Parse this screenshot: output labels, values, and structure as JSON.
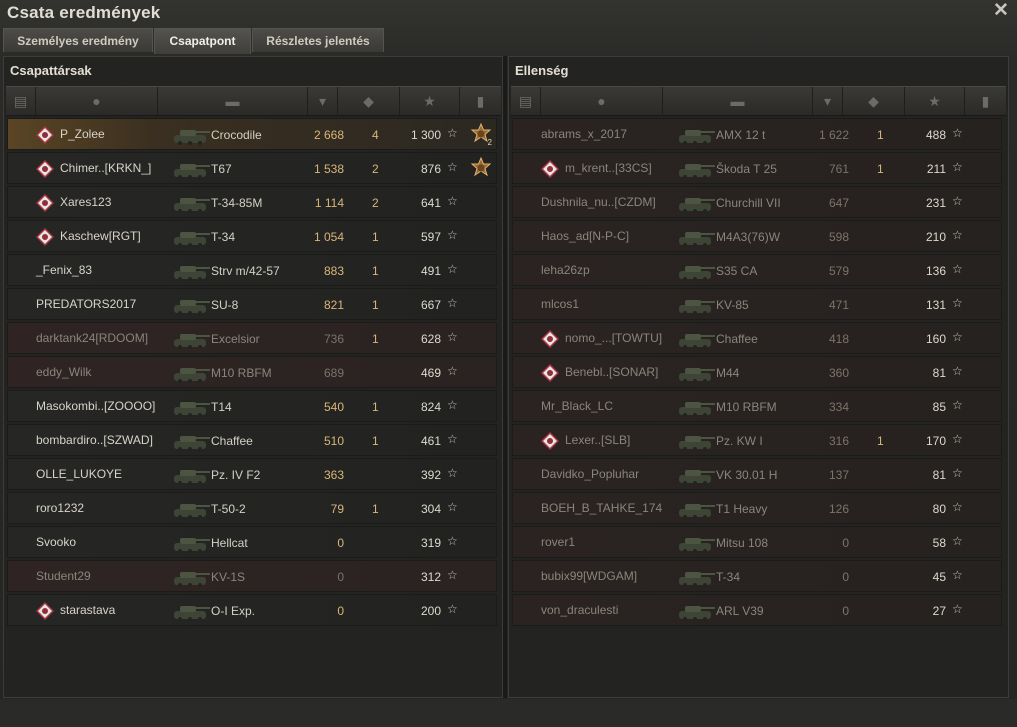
{
  "window": {
    "title": "Csata eredmények"
  },
  "tabs": [
    {
      "label": "Személyes eredmény",
      "active": false
    },
    {
      "label": "Csapatpont",
      "active": true
    },
    {
      "label": "Részletes jelentés",
      "active": false
    }
  ],
  "allies": {
    "title": "Csapattársak",
    "rows": [
      {
        "name": "P_Zolee",
        "vehicle": "Crocodile",
        "damage": "2 668",
        "kills": "4",
        "xp": "1 300",
        "badge": "rank-badge-icon",
        "medal": "2",
        "style": "me"
      },
      {
        "name": "Chimer..[KRKN_]",
        "vehicle": "T67",
        "damage": "1 538",
        "kills": "2",
        "xp": "876",
        "badge": "rank-badge-icon",
        "medal": "",
        "style": ""
      },
      {
        "name": "Xares123",
        "vehicle": "T-34-85M",
        "damage": "1 114",
        "kills": "2",
        "xp": "641",
        "badge": "rank-badge-icon",
        "medal": "",
        "style": ""
      },
      {
        "name": "Kaschew[RGT]",
        "vehicle": "T-34",
        "damage": "1 054",
        "kills": "1",
        "xp": "597",
        "badge": "rank-badge-icon",
        "medal": "",
        "style": ""
      },
      {
        "name": "_Fenix_83",
        "vehicle": "Strv m/42-57",
        "damage": "883",
        "kills": "1",
        "xp": "491",
        "badge": "",
        "medal": "",
        "style": ""
      },
      {
        "name": "PREDATORS2017",
        "vehicle": "SU-8",
        "damage": "821",
        "kills": "1",
        "xp": "667",
        "badge": "",
        "medal": "",
        "style": ""
      },
      {
        "name": "darktank24[RDOOM]",
        "vehicle": "Excelsior",
        "damage": "736",
        "kills": "1",
        "xp": "628",
        "badge": "",
        "medal": "",
        "style": "dead"
      },
      {
        "name": "eddy_Wilk",
        "vehicle": "M10 RBFM",
        "damage": "689",
        "kills": "",
        "xp": "469",
        "badge": "",
        "medal": "",
        "style": "dead"
      },
      {
        "name": "Masokombi..[ZOOOO]",
        "vehicle": "T14",
        "damage": "540",
        "kills": "1",
        "xp": "824",
        "badge": "",
        "medal": "",
        "style": ""
      },
      {
        "name": "bombardiro..[SZWAD]",
        "vehicle": "Chaffee",
        "damage": "510",
        "kills": "1",
        "xp": "461",
        "badge": "",
        "medal": "",
        "style": ""
      },
      {
        "name": "OLLE_LUKOYE",
        "vehicle": "Pz. IV F2",
        "damage": "363",
        "kills": "",
        "xp": "392",
        "badge": "",
        "medal": "",
        "style": ""
      },
      {
        "name": "roro1232",
        "vehicle": "T-50-2",
        "damage": "79",
        "kills": "1",
        "xp": "304",
        "badge": "",
        "medal": "",
        "style": ""
      },
      {
        "name": "Svooko",
        "vehicle": "Hellcat",
        "damage": "0",
        "kills": "",
        "xp": "319",
        "badge": "",
        "medal": "",
        "style": ""
      },
      {
        "name": "Student29",
        "vehicle": "KV-1S",
        "damage": "0",
        "kills": "",
        "xp": "312",
        "badge": "",
        "medal": "",
        "style": "dead"
      },
      {
        "name": "starastava",
        "vehicle": "O-I Exp.",
        "damage": "0",
        "kills": "",
        "xp": "200",
        "badge": "rank-badge-icon",
        "medal": "",
        "style": ""
      }
    ]
  },
  "enemies": {
    "title": "Ellenség",
    "rows": [
      {
        "name": "abrams_x_2017",
        "vehicle": "AMX 12 t",
        "damage": "1 622",
        "kills": "1",
        "xp": "488",
        "badge": "",
        "style": "dead"
      },
      {
        "name": "m_krent..[33CS]",
        "vehicle": "Škoda T 25",
        "damage": "761",
        "kills": "1",
        "xp": "211",
        "badge": "rank-badge-icon",
        "style": "dead"
      },
      {
        "name": "Dushnila_nu..[CZDM]",
        "vehicle": "Churchill VII",
        "damage": "647",
        "kills": "",
        "xp": "231",
        "badge": "",
        "style": "dead"
      },
      {
        "name": "Haos_ad[N-P-C]",
        "vehicle": "M4A3(76)W",
        "damage": "598",
        "kills": "",
        "xp": "210",
        "badge": "",
        "style": "dead"
      },
      {
        "name": "leha26zp",
        "vehicle": "S35 CA",
        "damage": "579",
        "kills": "",
        "xp": "136",
        "badge": "",
        "style": "dead"
      },
      {
        "name": "mlcos1",
        "vehicle": "KV-85",
        "damage": "471",
        "kills": "",
        "xp": "131",
        "badge": "",
        "style": "dead"
      },
      {
        "name": "nomo_...[TOWTU]",
        "vehicle": "Chaffee",
        "damage": "418",
        "kills": "",
        "xp": "160",
        "badge": "rank-badge-icon",
        "style": "dead"
      },
      {
        "name": "Benebl..[SONAR]",
        "vehicle": "M44",
        "damage": "360",
        "kills": "",
        "xp": "81",
        "badge": "rank-badge-icon",
        "style": "dead"
      },
      {
        "name": "Mr_Black_LC",
        "vehicle": "M10 RBFM",
        "damage": "334",
        "kills": "",
        "xp": "85",
        "badge": "",
        "style": "dead"
      },
      {
        "name": "Lexer..[SLB]",
        "vehicle": "Pz. KW I",
        "damage": "316",
        "kills": "1",
        "xp": "170",
        "badge": "rank-badge-icon",
        "style": "dead"
      },
      {
        "name": "Davidko_Popluhar",
        "vehicle": "VK 30.01 H",
        "damage": "137",
        "kills": "",
        "xp": "81",
        "badge": "",
        "style": "dead"
      },
      {
        "name": "BOEH_B_TAHKE_174",
        "vehicle": "T1 Heavy",
        "damage": "126",
        "kills": "",
        "xp": "80",
        "badge": "",
        "style": "dead"
      },
      {
        "name": "rover1",
        "vehicle": "Mitsu 108",
        "damage": "0",
        "kills": "",
        "xp": "58",
        "badge": "",
        "style": "dead"
      },
      {
        "name": "bubix99[WDGAM]",
        "vehicle": "T-34",
        "damage": "0",
        "kills": "",
        "xp": "45",
        "badge": "",
        "style": "dead"
      },
      {
        "name": "von_draculesti",
        "vehicle": "ARL V39",
        "damage": "0",
        "kills": "",
        "xp": "27",
        "badge": "",
        "style": "dead"
      }
    ]
  },
  "icons": {
    "close": "close-icon",
    "star": "star-icon"
  },
  "colors": {
    "damage": "#d8b679",
    "highlight": "#5a4524"
  }
}
